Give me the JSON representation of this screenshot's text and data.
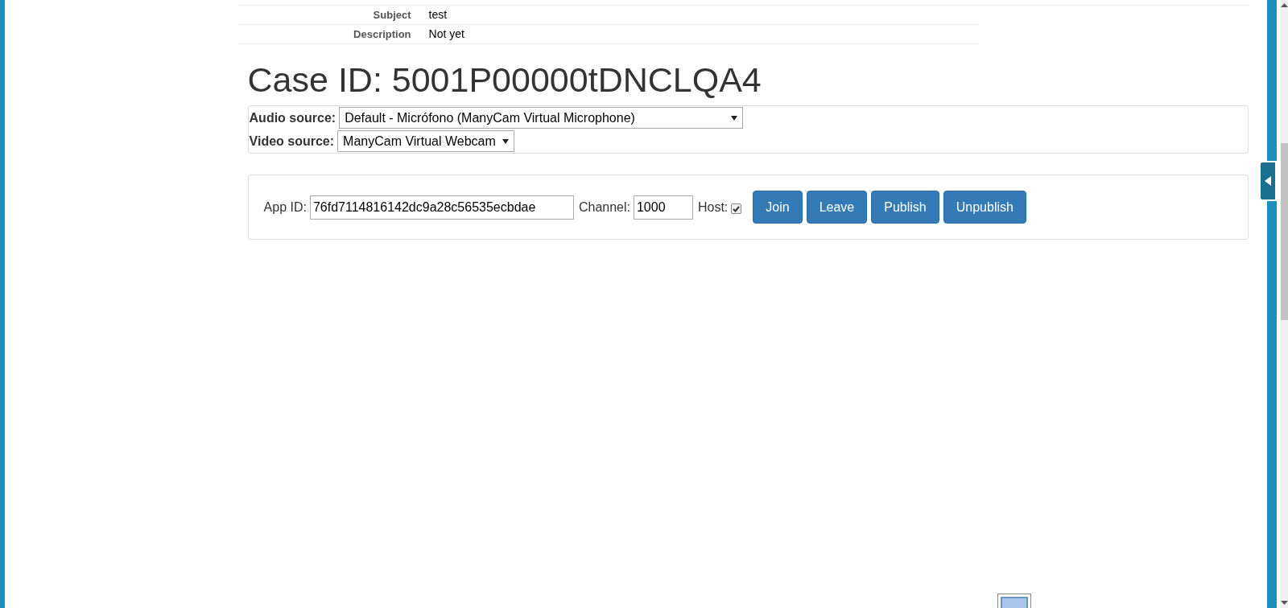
{
  "details": [
    {
      "label": "Subject",
      "value": "test"
    },
    {
      "label": "Description",
      "value": "Not yet"
    }
  ],
  "case_title": "Case ID: 5001P00000tDNCLQA4",
  "sources": [
    {
      "label": "Audio source:",
      "value": "Default - Micrófono (ManyCam Virtual Microphone)"
    },
    {
      "label": "Video source:",
      "value": "ManyCam Virtual Webcam"
    }
  ],
  "session": {
    "app_id_label": "App ID:",
    "app_id": "76fd7114816142dc9a28c56535ecbdae",
    "channel_label": "Channel:",
    "channel": "1000",
    "host_label": "Host:",
    "host_checked": true,
    "buttons": [
      "Join",
      "Leave",
      "Publish",
      "Unpublish"
    ]
  }
}
